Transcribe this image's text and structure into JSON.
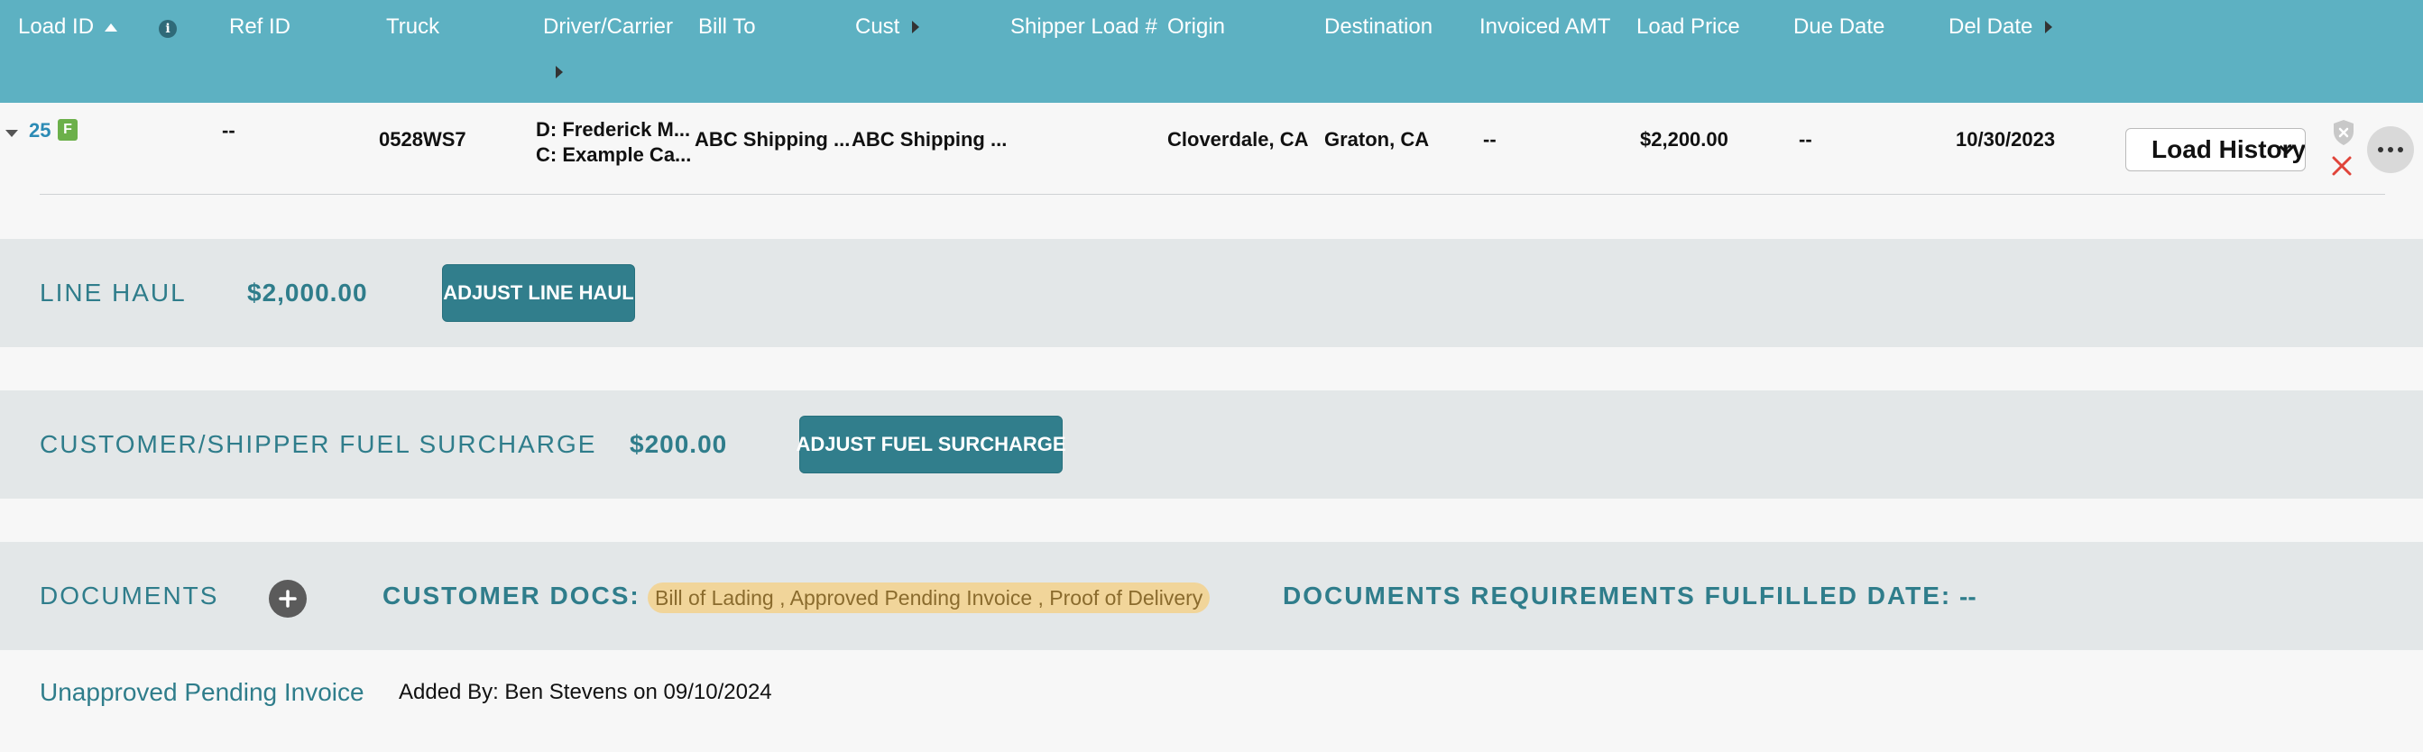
{
  "header": {
    "columns": {
      "load_id": "Load ID",
      "ref_id": "Ref ID",
      "truck": "Truck",
      "driver_carrier": "Driver/Carrier",
      "bill_to": "Bill To",
      "cust": "Cust",
      "shipper_load": "Shipper Load #",
      "origin": "Origin",
      "destination": "Destination",
      "invoiced_amt": "Invoiced AMT",
      "load_price": "Load Price",
      "due_date": "Due Date",
      "del_date": "Del Date"
    }
  },
  "load": {
    "id": "25",
    "badge": "F",
    "ref_id": "--",
    "truck": "0528WS7",
    "driver": "D: Frederick M...",
    "carrier": "C: Example Ca...",
    "bill_to": "ABC Shipping ...",
    "cust": "ABC Shipping ...",
    "origin": "Cloverdale, CA",
    "destination": "Graton, CA",
    "invoiced_amt": "--",
    "load_price": "$2,200.00",
    "due_date": "--",
    "del_date": "10/30/2023",
    "history_select": "Load History"
  },
  "line_haul": {
    "label": "LINE HAUL",
    "amount": "$2,000.00",
    "button": "ADJUST LINE HAUL"
  },
  "fuel_surcharge": {
    "label": "CUSTOMER/SHIPPER FUEL SURCHARGE",
    "amount": "$200.00",
    "button": "ADJUST FUEL SURCHARGE"
  },
  "documents": {
    "label": "DOCUMENTS",
    "customer_docs_label": "CUSTOMER DOCS:",
    "customer_docs": "Bill of Lading , Approved Pending Invoice , Proof of Delivery",
    "fulfilled_label": "DOCUMENTS REQUIREMENTS FULFILLED DATE:",
    "fulfilled_value": "--",
    "items": [
      {
        "name": "Unapproved Pending Invoice",
        "added_by": "Added By: Ben Stevens on 09/10/2024"
      }
    ]
  },
  "colors": {
    "header_bg": "#5db1c2",
    "accent": "#2f7d8b",
    "button_bg": "#317e8c",
    "pill_bg": "#f1d59a",
    "link": "#2c8bb5",
    "delete": "#e0443a"
  }
}
